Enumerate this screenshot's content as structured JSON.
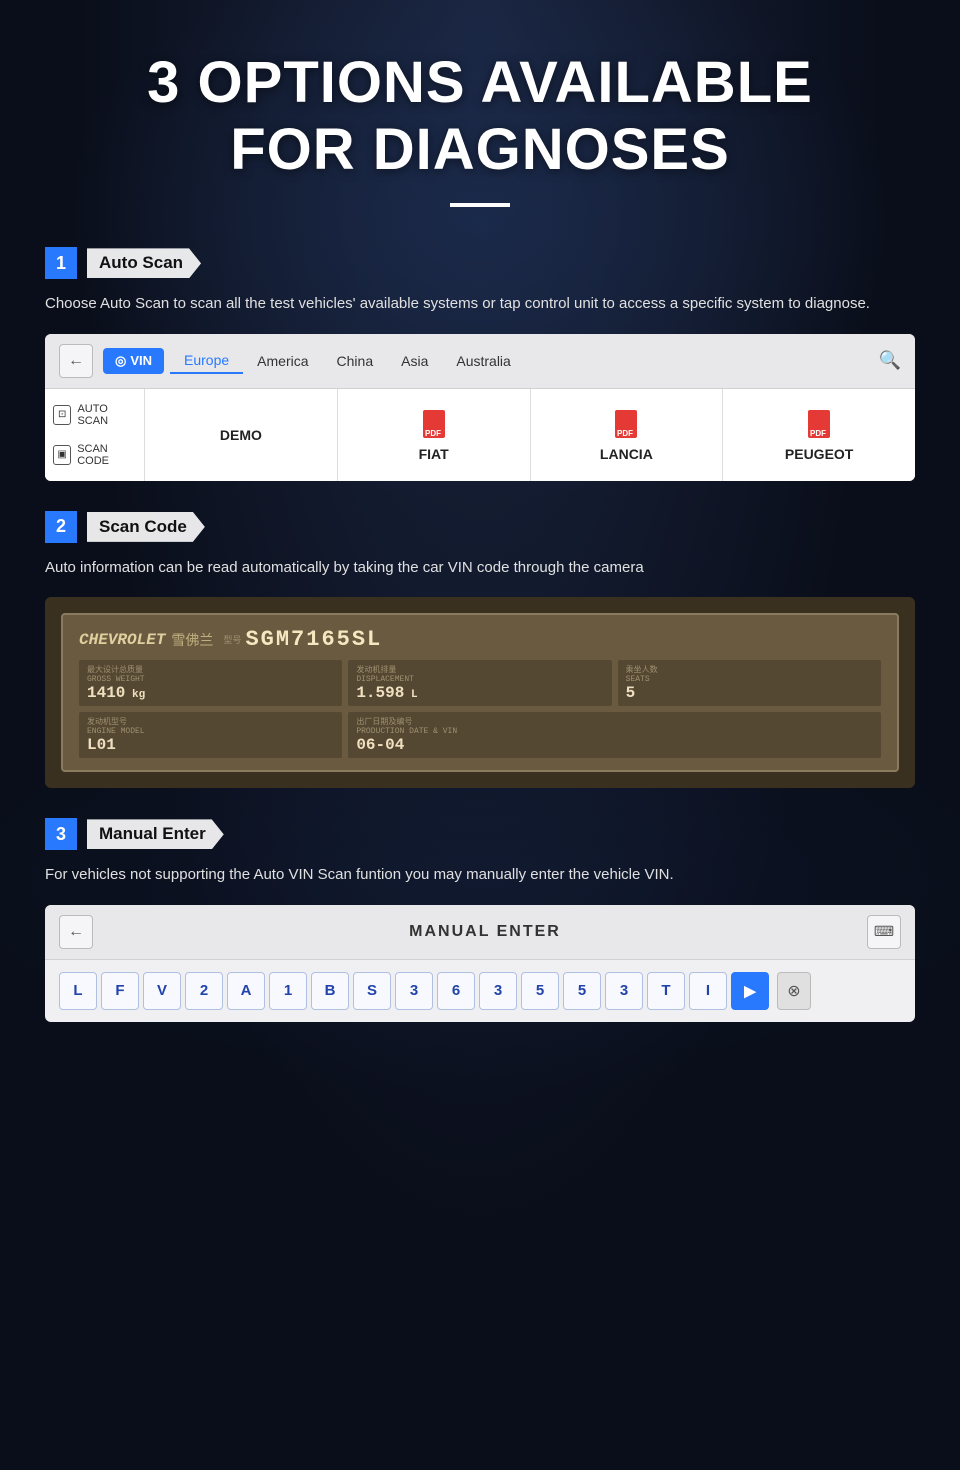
{
  "header": {
    "title_line1": "3 OPTIONS AVAILABLE",
    "title_line2": "FOR DIAGNOSES"
  },
  "sections": [
    {
      "number": "1",
      "title": "Auto Scan",
      "description": "Choose Auto Scan to scan all the test vehicles' available systems or tap control unit to access a specific system to diagnose."
    },
    {
      "number": "2",
      "title": "Scan Code",
      "description": "Auto information can be read automatically by taking the car VIN code through the camera"
    },
    {
      "number": "3",
      "title": "Manual Enter",
      "description": "For vehicles not supporting the Auto VIN Scan funtion you may manually enter the vehicle VIN."
    }
  ],
  "scan_panel": {
    "back_label": "←",
    "vin_badge": "VIN",
    "tabs": [
      "Europe",
      "America",
      "China",
      "Asia",
      "Australia"
    ],
    "active_tab": "Europe",
    "sidebar_items": [
      "AUTO SCAN",
      "SCAN CODE"
    ],
    "brands": [
      "DEMO",
      "FIAT",
      "LANCIA",
      "PEUGEOT"
    ]
  },
  "vin_plate": {
    "brand": "CHEVROLET",
    "chinese": "雪佛兰",
    "type_label": "型号",
    "model_value": "SGM7165SL",
    "gross_weight_label": "最大设计总质量",
    "gross_weight_sublabel": "GROSS WEIGHT",
    "gross_weight_value": "1410",
    "gross_weight_unit": "kg",
    "displacement_label": "发动机排量",
    "displacement_sublabel": "DISPLACEMENT",
    "displacement_value": "1.598",
    "displacement_unit": "L",
    "seats_label": "乘坐人数",
    "seats_sublabel": "SEATS",
    "seats_value": "5",
    "engine_model_label": "发动机型号",
    "engine_model_sublabel": "ENGINE MODEL",
    "engine_model_value": "L01",
    "production_label": "出厂日期及编号",
    "production_sublabel": "PRODUCTION DATE & VIN",
    "production_value": "06-04"
  },
  "manual_panel": {
    "back_label": "←",
    "title": "MANUAL ENTER",
    "qr_icon": "⌨",
    "vin_chars": [
      "L",
      "F",
      "V",
      "2",
      "A",
      "1",
      "B",
      "S",
      "3",
      "6",
      "3",
      "5",
      "5",
      "3",
      "T",
      "I",
      "▶"
    ],
    "delete_icon": "⊗"
  }
}
